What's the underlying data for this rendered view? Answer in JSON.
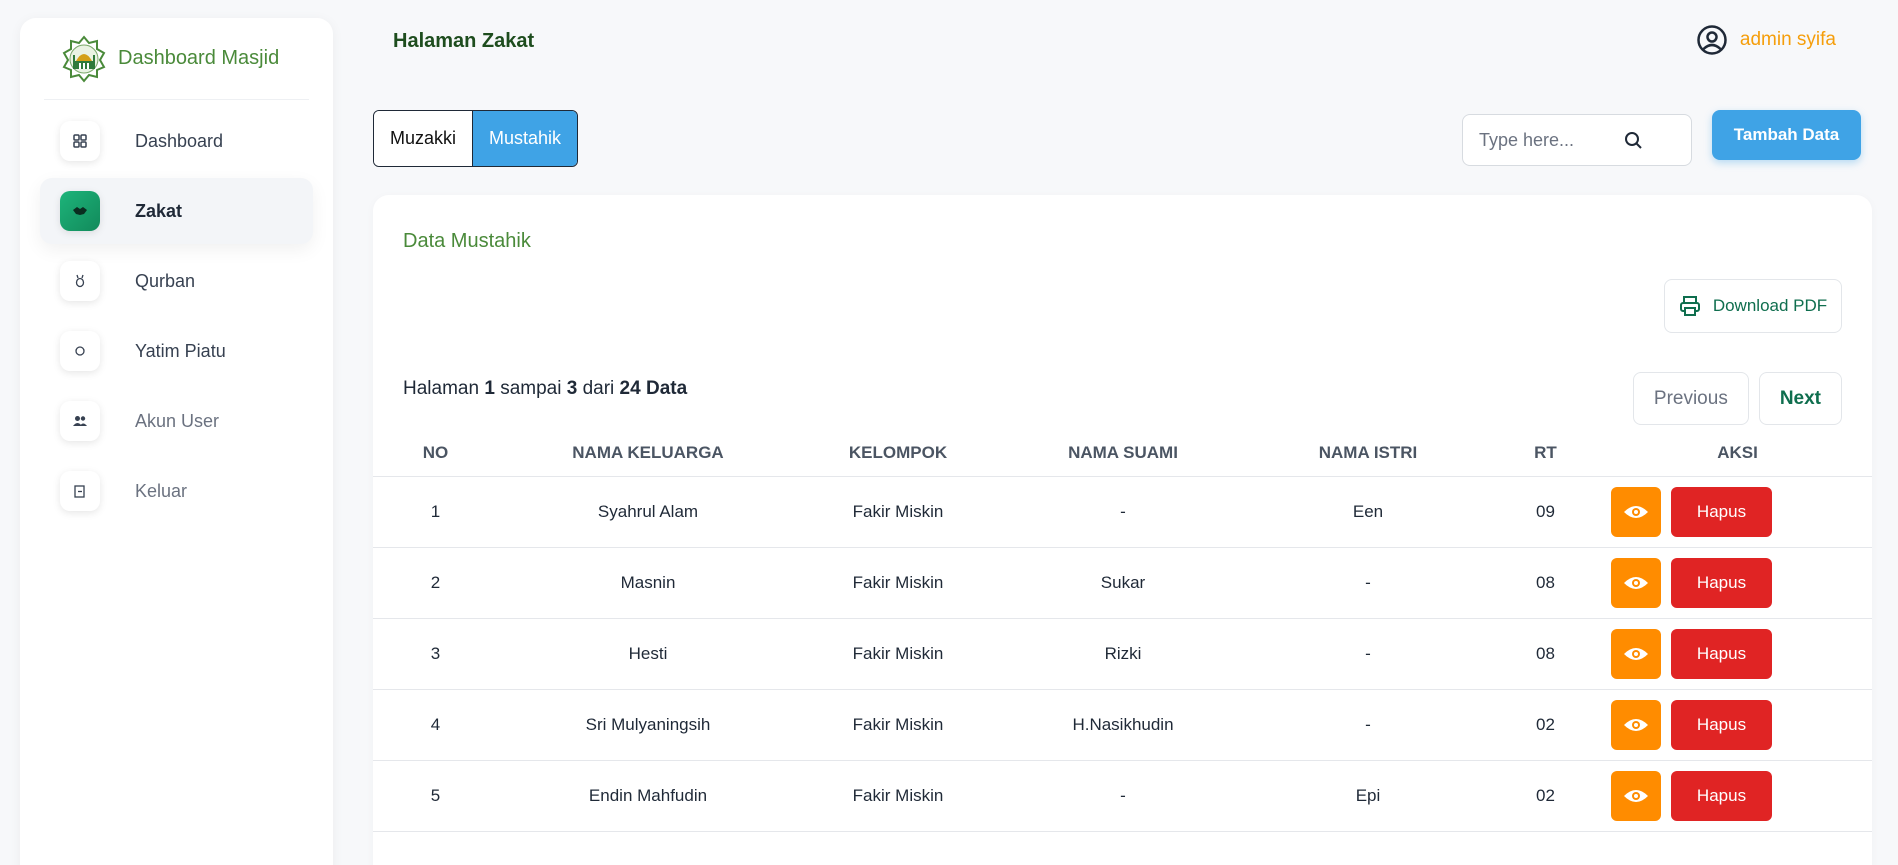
{
  "brand": {
    "name": "Dashboard Masjid"
  },
  "sidebar": {
    "items": [
      {
        "label": "Dashboard",
        "icon": "grid-icon"
      },
      {
        "label": "Zakat",
        "icon": "handshake-icon"
      },
      {
        "label": "Qurban",
        "icon": "goat-icon"
      },
      {
        "label": "Yatim Piatu",
        "icon": "child-icon"
      },
      {
        "label": "Akun User",
        "icon": "users-icon"
      },
      {
        "label": "Keluar",
        "icon": "logout-icon"
      }
    ]
  },
  "header": {
    "title": "Halaman Zakat",
    "user_name": "admin syifa"
  },
  "toggle": {
    "muzakki": "Muzakki",
    "mustahik": "Mustahik"
  },
  "search": {
    "placeholder": "Type here..."
  },
  "toolbar": {
    "add_label": "Tambah Data"
  },
  "card": {
    "title": "Data Mustahik",
    "pdf_label": "Download PDF",
    "page_info": {
      "prefix": "Halaman",
      "from": "1",
      "mid": "sampai",
      "to": "3",
      "of": "dari",
      "total": "24",
      "suffix": "Data"
    },
    "prev_label": "Previous",
    "next_label": "Next"
  },
  "table": {
    "headers": [
      "NO",
      "NAMA KELUARGA",
      "KELOMPOK",
      "NAMA SUAMI",
      "NAMA ISTRI",
      "RT",
      "AKSI"
    ],
    "delete_label": "Hapus",
    "rows": [
      {
        "no": "1",
        "keluarga": "Syahrul Alam",
        "kelompok": "Fakir Miskin",
        "suami": "-",
        "istri": "Een",
        "rt": "09"
      },
      {
        "no": "2",
        "keluarga": "Masnin",
        "kelompok": "Fakir Miskin",
        "suami": "Sukar",
        "istri": "-",
        "rt": "08"
      },
      {
        "no": "3",
        "keluarga": "Hesti",
        "kelompok": "Fakir Miskin",
        "suami": "Rizki",
        "istri": "-",
        "rt": "08"
      },
      {
        "no": "4",
        "keluarga": "Sri Mulyaningsih",
        "kelompok": "Fakir Miskin",
        "suami": "H.Nasikhudin",
        "istri": "-",
        "rt": "02"
      },
      {
        "no": "5",
        "keluarga": "Endin Mahfudin",
        "kelompok": "Fakir Miskin",
        "suami": "-",
        "istri": "Epi",
        "rt": "02"
      }
    ]
  },
  "colors": {
    "brand_green": "#4a8a3a",
    "primary_blue": "#3fa3e6",
    "view_orange": "#ff8c00",
    "delete_red": "#e02424",
    "user_orange": "#f59e0b"
  }
}
